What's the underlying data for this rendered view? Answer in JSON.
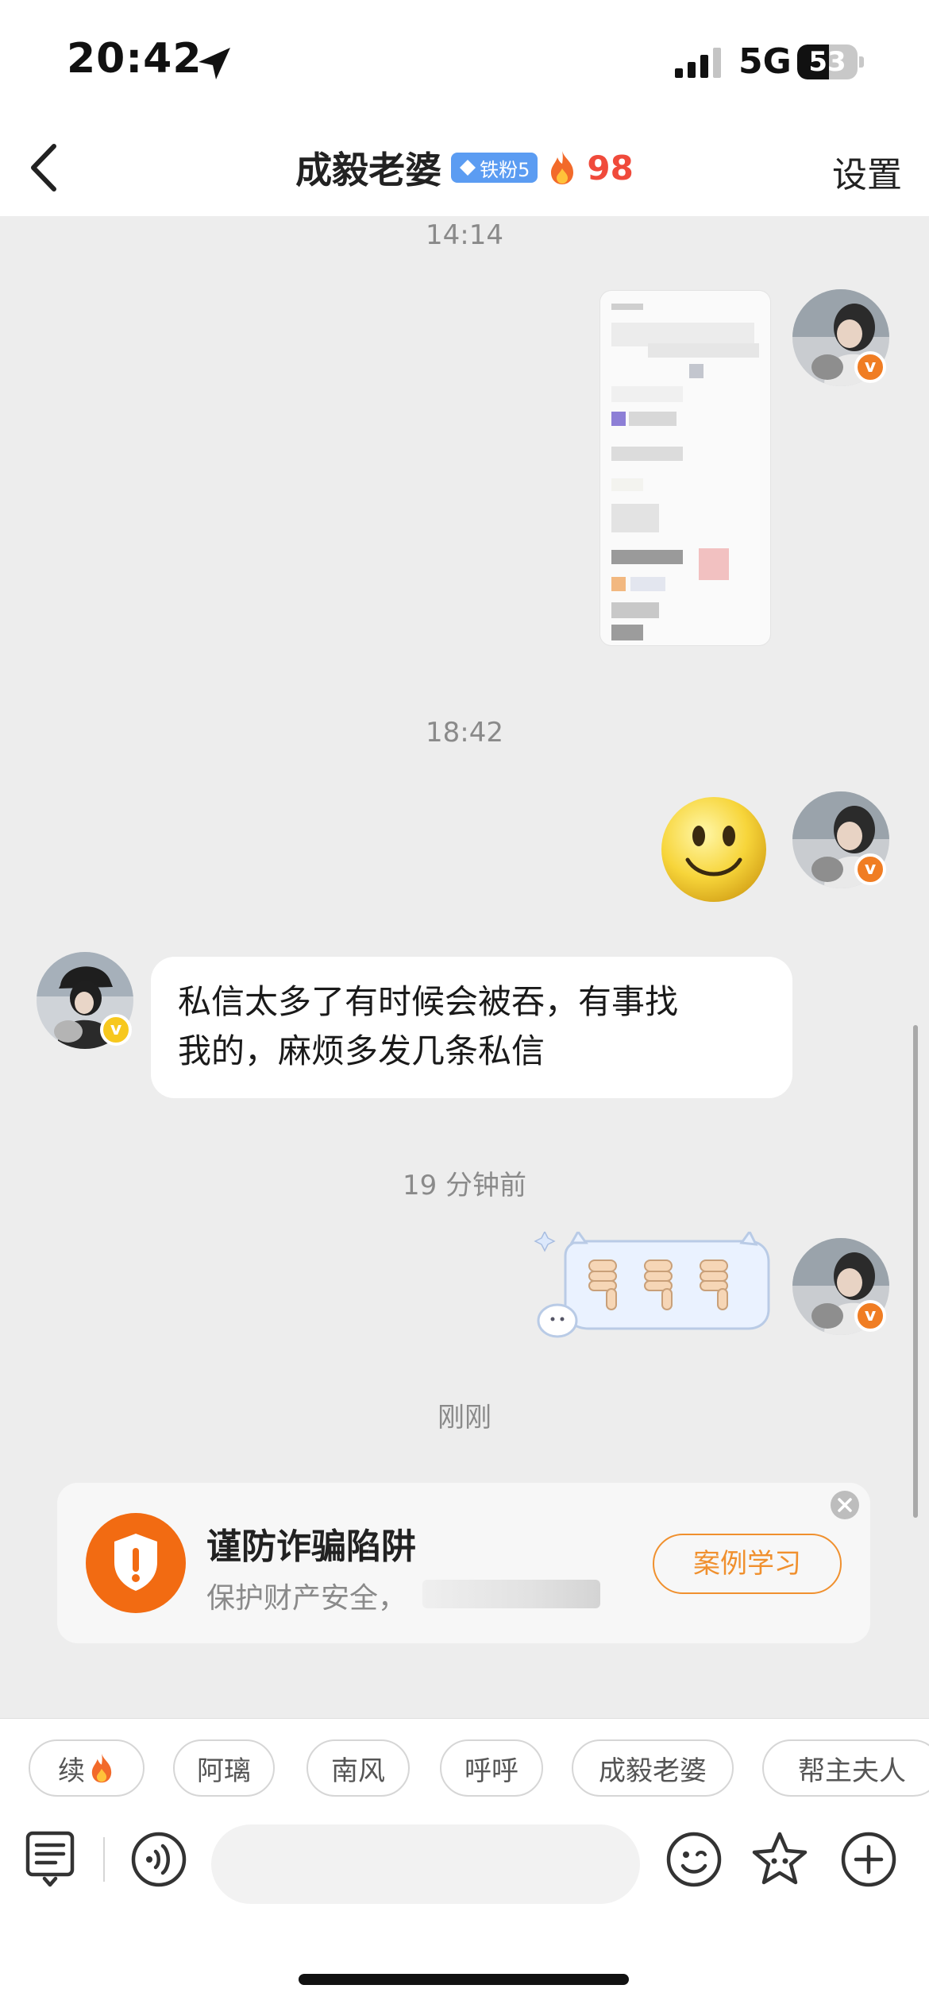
{
  "status_bar": {
    "time": "20:42",
    "network": "5G",
    "battery": "53",
    "battery_level": 0.53
  },
  "header": {
    "title": "成毅老婆",
    "fan_badge": "铁粉5",
    "fire_count": "98",
    "settings_label": "设置"
  },
  "messages": {
    "ts1": "14:14",
    "ts2": "18:42",
    "incoming_text_line1": "私信太多了有时候会被吞，有事找",
    "incoming_text_line2": "我的，麻烦多发几条私信",
    "ts3": "19 分钟前",
    "ts4": "刚刚"
  },
  "fraud_card": {
    "title": "谨防诈骗陷阱",
    "subtitle": "保护财产安全，",
    "button_label": "案例学习"
  },
  "quick_replies": [
    "续",
    "阿璃",
    "南风",
    "呼呼",
    "成毅老婆",
    "帮主夫人"
  ],
  "input": {
    "placeholder": ""
  },
  "colors": {
    "accent_orange": "#f0902e",
    "fire_red": "#f04a3b",
    "badge_blue": "#5b9cf2",
    "chat_bg": "#ededed"
  }
}
